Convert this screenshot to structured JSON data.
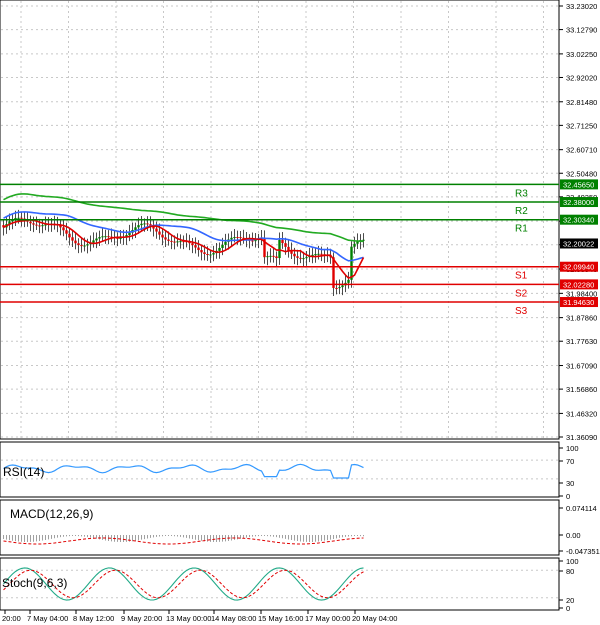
{
  "main": {
    "price_ticks": [
      "33.23020",
      "33.12790",
      "33.02250",
      "32.92020",
      "32.81480",
      "32.71250",
      "32.60710",
      "32.50480",
      "32.40250",
      "32.29710",
      "32.19480",
      "32.08940",
      "31.98400",
      "31.87860",
      "31.77630",
      "31.67090",
      "31.56860",
      "31.46320",
      "31.36090"
    ],
    "current_price": "32.20022",
    "levels": [
      {
        "name": "R3",
        "value": "32.45650",
        "color": "#008000"
      },
      {
        "name": "R2",
        "value": "32.38000",
        "color": "#008000"
      },
      {
        "name": "R1",
        "value": "32.30340",
        "color": "#008000"
      },
      {
        "name": "S1",
        "value": "32.09940",
        "color": "#e00000"
      },
      {
        "name": "S2",
        "value": "32.02280",
        "color": "#e00000"
      },
      {
        "name": "S3",
        "value": "31.94630",
        "color": "#e00000"
      }
    ]
  },
  "rsi": {
    "label": "RSI(14)",
    "ticks": [
      "100",
      "70",
      "30",
      "0"
    ]
  },
  "macd": {
    "label": "MACD(12,26,9)",
    "ticks": [
      "0.074114",
      "0.00",
      "-0.047351"
    ]
  },
  "stoch": {
    "label": "Stoch(9,6,3)",
    "ticks": [
      "100",
      "80",
      "20",
      "0"
    ]
  },
  "time_axis": [
    "20:00",
    "7 May 04:00",
    "8 May 12:00",
    "9 May 20:00",
    "13 May 00:00",
    "14 May 08:00",
    "15 May 16:00",
    "17 May 00:00",
    "20 May 04:00"
  ],
  "colors": {
    "bull": "#008000",
    "bear": "#e00000",
    "ma_fast": "#e00000",
    "ma_mid": "#3366ff",
    "ma_slow": "#22aa22",
    "rsi": "#3399ff"
  }
}
